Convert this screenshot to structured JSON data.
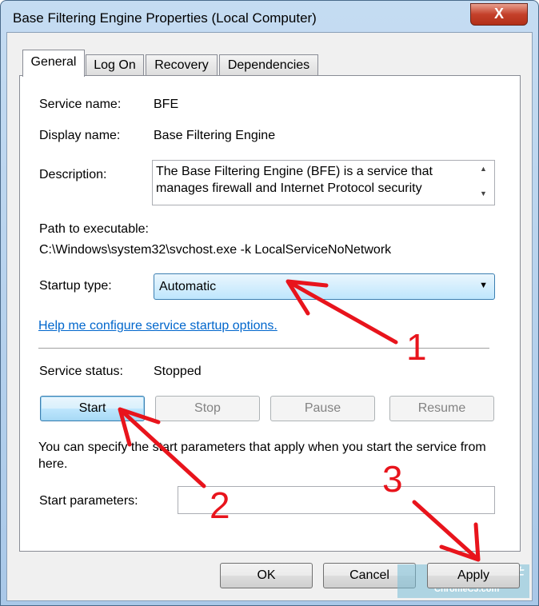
{
  "window": {
    "title": "Base Filtering Engine Properties (Local Computer)",
    "close": "X"
  },
  "tabs": [
    {
      "label": "General",
      "selected": true
    },
    {
      "label": "Log On"
    },
    {
      "label": "Recovery"
    },
    {
      "label": "Dependencies"
    }
  ],
  "general": {
    "service_name_label": "Service name:",
    "service_name": "BFE",
    "display_name_label": "Display name:",
    "display_name": "Base Filtering Engine",
    "description_label": "Description:",
    "description": "The Base Filtering Engine (BFE) is a service that manages firewall and Internet Protocol security",
    "path_label": "Path to executable:",
    "path": "C:\\Windows\\system32\\svchost.exe -k LocalServiceNoNetwork",
    "startup_type_label": "Startup type:",
    "startup_type": "Automatic",
    "help_link": "Help me configure service startup options.",
    "status_label": "Service status:",
    "status": "Stopped",
    "buttons": {
      "start": "Start",
      "stop": "Stop",
      "pause": "Pause",
      "resume": "Resume"
    },
    "hint": "You can specify the start parameters that apply when you start the service from here.",
    "start_params_label": "Start parameters:",
    "start_params": ""
  },
  "footer": {
    "ok": "OK",
    "cancel": "Cancel",
    "apply": "Apply"
  },
  "annotations": {
    "one": "1",
    "two": "2",
    "three": "3",
    "color": "#e8141c"
  },
  "watermark": {
    "text": "Chrome插件",
    "sub": "ChromeCJ.com"
  }
}
